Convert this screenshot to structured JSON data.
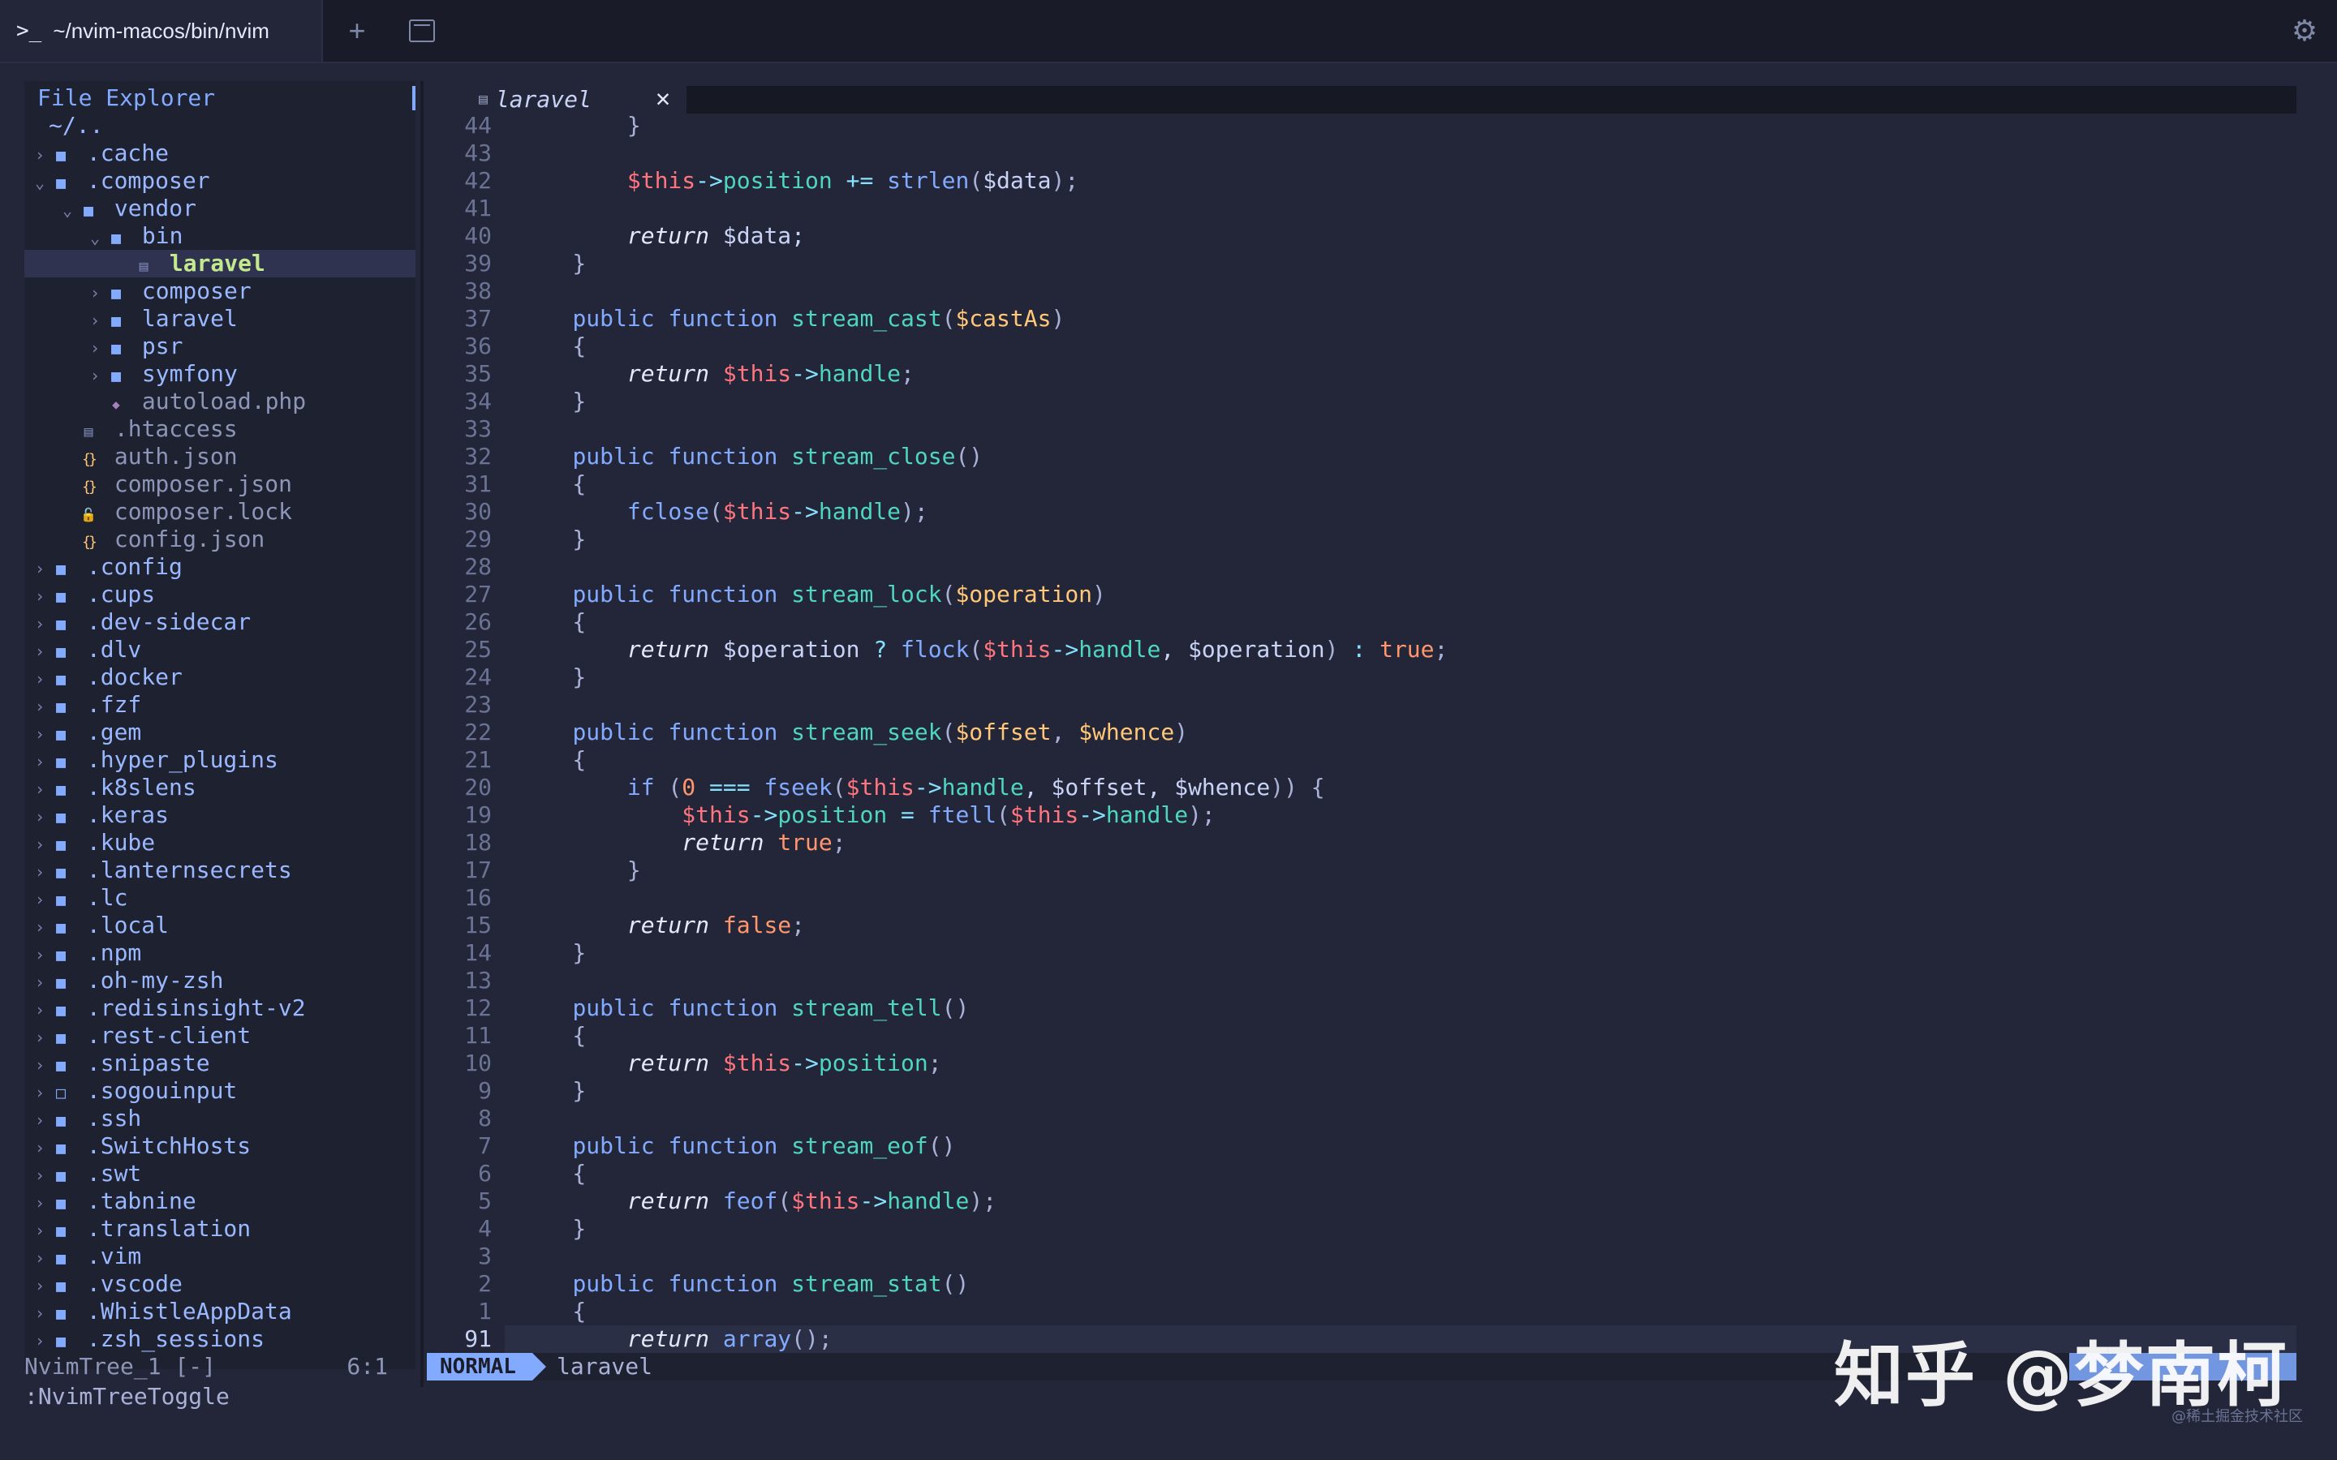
{
  "window": {
    "tab_title": "~/nvim-macos/bin/nvim",
    "prompt_icon": "terminal-prompt-icon",
    "plus_icon": "plus-icon",
    "tabs_icon": "tab-overview-icon",
    "gear_icon": "gear-icon"
  },
  "tree": {
    "header": "File Explorer",
    "rows": [
      {
        "indent": 0,
        "chev": "",
        "icon": "",
        "name": "~/..",
        "style": "plain"
      },
      {
        "indent": 0,
        "chev": "›",
        "icon": "folder",
        "name": ".cache",
        "style": "plain"
      },
      {
        "indent": 0,
        "chev": "⌄",
        "icon": "folder",
        "name": ".composer",
        "style": "plain"
      },
      {
        "indent": 1,
        "chev": "⌄",
        "icon": "folder",
        "name": "vendor",
        "style": "plain"
      },
      {
        "indent": 2,
        "chev": "⌄",
        "icon": "folder",
        "name": "bin",
        "style": "plain"
      },
      {
        "indent": 3,
        "chev": "",
        "icon": "file",
        "name": "laravel",
        "style": "bold",
        "selected": true
      },
      {
        "indent": 2,
        "chev": "›",
        "icon": "folder",
        "name": "composer",
        "style": "plain"
      },
      {
        "indent": 2,
        "chev": "›",
        "icon": "folder",
        "name": "laravel",
        "style": "plain"
      },
      {
        "indent": 2,
        "chev": "›",
        "icon": "folder",
        "name": "psr",
        "style": "plain"
      },
      {
        "indent": 2,
        "chev": "›",
        "icon": "folder",
        "name": "symfony",
        "style": "plain"
      },
      {
        "indent": 2,
        "chev": "",
        "icon": "php",
        "name": "autoload.php",
        "style": "dim"
      },
      {
        "indent": 1,
        "chev": "",
        "icon": "file",
        "name": ".htaccess",
        "style": "dim"
      },
      {
        "indent": 1,
        "chev": "",
        "icon": "json",
        "name": "auth.json",
        "style": "dim"
      },
      {
        "indent": 1,
        "chev": "",
        "icon": "json",
        "name": "composer.json",
        "style": "dim"
      },
      {
        "indent": 1,
        "chev": "",
        "icon": "lock",
        "name": "composer.lock",
        "style": "dim"
      },
      {
        "indent": 1,
        "chev": "",
        "icon": "json",
        "name": "config.json",
        "style": "dim"
      },
      {
        "indent": 0,
        "chev": "›",
        "icon": "folder",
        "name": ".config",
        "style": "plain"
      },
      {
        "indent": 0,
        "chev": "›",
        "icon": "folder",
        "name": ".cups",
        "style": "plain"
      },
      {
        "indent": 0,
        "chev": "›",
        "icon": "folder",
        "name": ".dev-sidecar",
        "style": "plain"
      },
      {
        "indent": 0,
        "chev": "›",
        "icon": "folder",
        "name": ".dlv",
        "style": "plain"
      },
      {
        "indent": 0,
        "chev": "›",
        "icon": "folder",
        "name": ".docker",
        "style": "plain"
      },
      {
        "indent": 0,
        "chev": "›",
        "icon": "folder",
        "name": ".fzf",
        "style": "plain"
      },
      {
        "indent": 0,
        "chev": "›",
        "icon": "folder",
        "name": ".gem",
        "style": "plain"
      },
      {
        "indent": 0,
        "chev": "›",
        "icon": "folder",
        "name": ".hyper_plugins",
        "style": "plain"
      },
      {
        "indent": 0,
        "chev": "›",
        "icon": "folder",
        "name": ".k8slens",
        "style": "plain"
      },
      {
        "indent": 0,
        "chev": "›",
        "icon": "folder",
        "name": ".keras",
        "style": "plain"
      },
      {
        "indent": 0,
        "chev": "›",
        "icon": "folder",
        "name": ".kube",
        "style": "plain"
      },
      {
        "indent": 0,
        "chev": "›",
        "icon": "folder",
        "name": ".lanternsecrets",
        "style": "plain"
      },
      {
        "indent": 0,
        "chev": "›",
        "icon": "folder",
        "name": ".lc",
        "style": "plain"
      },
      {
        "indent": 0,
        "chev": "›",
        "icon": "folder",
        "name": ".local",
        "style": "plain"
      },
      {
        "indent": 0,
        "chev": "›",
        "icon": "folder",
        "name": ".npm",
        "style": "plain"
      },
      {
        "indent": 0,
        "chev": "›",
        "icon": "folder",
        "name": ".oh-my-zsh",
        "style": "plain"
      },
      {
        "indent": 0,
        "chev": "›",
        "icon": "folder",
        "name": ".redisinsight-v2",
        "style": "plain"
      },
      {
        "indent": 0,
        "chev": "›",
        "icon": "folder",
        "name": ".rest-client",
        "style": "plain"
      },
      {
        "indent": 0,
        "chev": "›",
        "icon": "folder",
        "name": ".snipaste",
        "style": "plain"
      },
      {
        "indent": 0,
        "chev": "›",
        "icon": "folder-empty",
        "name": ".sogouinput",
        "style": "plain"
      },
      {
        "indent": 0,
        "chev": "›",
        "icon": "folder",
        "name": ".ssh",
        "style": "plain"
      },
      {
        "indent": 0,
        "chev": "›",
        "icon": "folder",
        "name": ".SwitchHosts",
        "style": "plain"
      },
      {
        "indent": 0,
        "chev": "›",
        "icon": "folder",
        "name": ".swt",
        "style": "plain"
      },
      {
        "indent": 0,
        "chev": "›",
        "icon": "folder",
        "name": ".tabnine",
        "style": "plain"
      },
      {
        "indent": 0,
        "chev": "›",
        "icon": "folder",
        "name": ".translation",
        "style": "plain"
      },
      {
        "indent": 0,
        "chev": "›",
        "icon": "folder",
        "name": ".vim",
        "style": "plain"
      },
      {
        "indent": 0,
        "chev": "›",
        "icon": "folder",
        "name": ".vscode",
        "style": "plain"
      },
      {
        "indent": 0,
        "chev": "›",
        "icon": "folder",
        "name": ".WhistleAppData",
        "style": "plain"
      },
      {
        "indent": 0,
        "chev": "›",
        "icon": "folder",
        "name": ".zsh_sessions",
        "style": "plain"
      }
    ],
    "status_name": "NvimTree_1 [-]",
    "status_pos": "6:1"
  },
  "editor": {
    "tab_label": "laravel",
    "tab_close": "✕",
    "lines": [
      {
        "n": "44",
        "tokens": [
          [
            "        }",
            "punc"
          ]
        ]
      },
      {
        "n": "43",
        "tokens": []
      },
      {
        "n": "42",
        "tokens": [
          [
            "        ",
            ""
          ],
          [
            "$this",
            "this"
          ],
          [
            "->",
            "op"
          ],
          [
            "position",
            "prop"
          ],
          [
            " += ",
            "op"
          ],
          [
            "strlen",
            "fn"
          ],
          [
            "(",
            "punc"
          ],
          [
            "$data",
            "var"
          ],
          [
            ");",
            "punc"
          ]
        ]
      },
      {
        "n": "41",
        "tokens": []
      },
      {
        "n": "40",
        "tokens": [
          [
            "        ",
            ""
          ],
          [
            "return",
            "ret"
          ],
          [
            " $data;",
            "var"
          ]
        ]
      },
      {
        "n": "39",
        "tokens": [
          [
            "    }",
            "punc"
          ]
        ]
      },
      {
        "n": "38",
        "tokens": []
      },
      {
        "n": "37",
        "tokens": [
          [
            "    ",
            ""
          ],
          [
            "public function ",
            "kw"
          ],
          [
            "stream_cast",
            "prop"
          ],
          [
            "(",
            "punc"
          ],
          [
            "$castAs",
            "param"
          ],
          [
            ")",
            "punc"
          ]
        ]
      },
      {
        "n": "36",
        "tokens": [
          [
            "    {",
            "punc"
          ]
        ]
      },
      {
        "n": "35",
        "tokens": [
          [
            "        ",
            ""
          ],
          [
            "return",
            "ret"
          ],
          [
            " ",
            ""
          ],
          [
            "$this",
            "this"
          ],
          [
            "->",
            "op"
          ],
          [
            "handle",
            "prop"
          ],
          [
            ";",
            "punc"
          ]
        ]
      },
      {
        "n": "34",
        "tokens": [
          [
            "    }",
            "punc"
          ]
        ]
      },
      {
        "n": "33",
        "tokens": []
      },
      {
        "n": "32",
        "tokens": [
          [
            "    ",
            ""
          ],
          [
            "public function ",
            "kw"
          ],
          [
            "stream_close",
            "prop"
          ],
          [
            "()",
            "punc"
          ]
        ]
      },
      {
        "n": "31",
        "tokens": [
          [
            "    {",
            "punc"
          ]
        ]
      },
      {
        "n": "30",
        "tokens": [
          [
            "        ",
            ""
          ],
          [
            "fclose",
            "fn"
          ],
          [
            "(",
            "punc"
          ],
          [
            "$this",
            "this"
          ],
          [
            "->",
            "op"
          ],
          [
            "handle",
            "prop"
          ],
          [
            ");",
            "punc"
          ]
        ]
      },
      {
        "n": "29",
        "tokens": [
          [
            "    }",
            "punc"
          ]
        ]
      },
      {
        "n": "28",
        "tokens": []
      },
      {
        "n": "27",
        "tokens": [
          [
            "    ",
            ""
          ],
          [
            "public function ",
            "kw"
          ],
          [
            "stream_lock",
            "prop"
          ],
          [
            "(",
            "punc"
          ],
          [
            "$operation",
            "param"
          ],
          [
            ")",
            "punc"
          ]
        ]
      },
      {
        "n": "26",
        "tokens": [
          [
            "    {",
            "punc"
          ]
        ]
      },
      {
        "n": "25",
        "tokens": [
          [
            "        ",
            ""
          ],
          [
            "return",
            "ret"
          ],
          [
            " $operation ",
            "var"
          ],
          [
            "?",
            "op"
          ],
          [
            " ",
            ""
          ],
          [
            "flock",
            "fn"
          ],
          [
            "(",
            "punc"
          ],
          [
            "$this",
            "this"
          ],
          [
            "->",
            "op"
          ],
          [
            "handle",
            "prop"
          ],
          [
            ", $operation",
            "var"
          ],
          [
            ")",
            "punc"
          ],
          [
            " : ",
            "op"
          ],
          [
            "true",
            "bool"
          ],
          [
            ";",
            "punc"
          ]
        ]
      },
      {
        "n": "24",
        "tokens": [
          [
            "    }",
            "punc"
          ]
        ]
      },
      {
        "n": "23",
        "tokens": []
      },
      {
        "n": "22",
        "tokens": [
          [
            "    ",
            ""
          ],
          [
            "public function ",
            "kw"
          ],
          [
            "stream_seek",
            "prop"
          ],
          [
            "(",
            "punc"
          ],
          [
            "$offset",
            "param"
          ],
          [
            ", ",
            "punc"
          ],
          [
            "$whence",
            "param"
          ],
          [
            ")",
            "punc"
          ]
        ]
      },
      {
        "n": "21",
        "tokens": [
          [
            "    {",
            "punc"
          ]
        ]
      },
      {
        "n": "20",
        "tokens": [
          [
            "        ",
            ""
          ],
          [
            "if",
            "kw"
          ],
          [
            " (",
            "punc"
          ],
          [
            "0",
            "num"
          ],
          [
            " === ",
            "op"
          ],
          [
            "fseek",
            "fn"
          ],
          [
            "(",
            "punc"
          ],
          [
            "$this",
            "this"
          ],
          [
            "->",
            "op"
          ],
          [
            "handle",
            "prop"
          ],
          [
            ", $offset, $whence",
            "var"
          ],
          [
            ")) {",
            "punc"
          ]
        ]
      },
      {
        "n": "19",
        "tokens": [
          [
            "            ",
            ""
          ],
          [
            "$this",
            "this"
          ],
          [
            "->",
            "op"
          ],
          [
            "position",
            "prop"
          ],
          [
            " = ",
            "op"
          ],
          [
            "ftell",
            "fn"
          ],
          [
            "(",
            "punc"
          ],
          [
            "$this",
            "this"
          ],
          [
            "->",
            "op"
          ],
          [
            "handle",
            "prop"
          ],
          [
            ");",
            "punc"
          ]
        ]
      },
      {
        "n": "18",
        "tokens": [
          [
            "            ",
            ""
          ],
          [
            "return",
            "ret"
          ],
          [
            " ",
            ""
          ],
          [
            "true",
            "bool"
          ],
          [
            ";",
            "punc"
          ]
        ]
      },
      {
        "n": "17",
        "tokens": [
          [
            "        }",
            "punc"
          ]
        ]
      },
      {
        "n": "16",
        "tokens": []
      },
      {
        "n": "15",
        "tokens": [
          [
            "        ",
            ""
          ],
          [
            "return",
            "ret"
          ],
          [
            " ",
            ""
          ],
          [
            "false",
            "bool"
          ],
          [
            ";",
            "punc"
          ]
        ]
      },
      {
        "n": "14",
        "tokens": [
          [
            "    }",
            "punc"
          ]
        ]
      },
      {
        "n": "13",
        "tokens": []
      },
      {
        "n": "12",
        "tokens": [
          [
            "    ",
            ""
          ],
          [
            "public function ",
            "kw"
          ],
          [
            "stream_tell",
            "prop"
          ],
          [
            "()",
            "punc"
          ]
        ]
      },
      {
        "n": "11",
        "tokens": [
          [
            "    {",
            "punc"
          ]
        ]
      },
      {
        "n": "10",
        "tokens": [
          [
            "        ",
            ""
          ],
          [
            "return",
            "ret"
          ],
          [
            " ",
            ""
          ],
          [
            "$this",
            "this"
          ],
          [
            "->",
            "op"
          ],
          [
            "position",
            "prop"
          ],
          [
            ";",
            "punc"
          ]
        ]
      },
      {
        "n": "9",
        "tokens": [
          [
            "    }",
            "punc"
          ]
        ]
      },
      {
        "n": "8",
        "tokens": []
      },
      {
        "n": "7",
        "tokens": [
          [
            "    ",
            ""
          ],
          [
            "public function ",
            "kw"
          ],
          [
            "stream_eof",
            "prop"
          ],
          [
            "()",
            "punc"
          ]
        ]
      },
      {
        "n": "6",
        "tokens": [
          [
            "    {",
            "punc"
          ]
        ]
      },
      {
        "n": "5",
        "tokens": [
          [
            "        ",
            ""
          ],
          [
            "return",
            "ret"
          ],
          [
            " ",
            ""
          ],
          [
            "feof",
            "fn"
          ],
          [
            "(",
            "punc"
          ],
          [
            "$this",
            "this"
          ],
          [
            "->",
            "op"
          ],
          [
            "handle",
            "prop"
          ],
          [
            ");",
            "punc"
          ]
        ]
      },
      {
        "n": "4",
        "tokens": [
          [
            "    }",
            "punc"
          ]
        ]
      },
      {
        "n": "3",
        "tokens": []
      },
      {
        "n": "2",
        "tokens": [
          [
            "    ",
            ""
          ],
          [
            "public function ",
            "kw"
          ],
          [
            "stream_stat",
            "prop"
          ],
          [
            "()",
            "punc"
          ]
        ]
      },
      {
        "n": "1",
        "tokens": [
          [
            "    {",
            "punc"
          ]
        ]
      },
      {
        "n": "91",
        "tokens": [
          [
            "        ",
            ""
          ],
          [
            "return",
            "ret"
          ],
          [
            " ",
            ""
          ],
          [
            "array",
            "fn"
          ],
          [
            "();",
            "punc"
          ]
        ],
        "current": true
      }
    ],
    "mode": "NORMAL",
    "status_file": "laravel"
  },
  "cmdline": ":NvimTreeToggle",
  "watermark": {
    "main": "知乎 @梦南柯",
    "small": "@稀土掘金技术社区"
  },
  "colors": {
    "background": "#232638",
    "accent": "#82aaff",
    "selected_file": "#c3e88d"
  }
}
